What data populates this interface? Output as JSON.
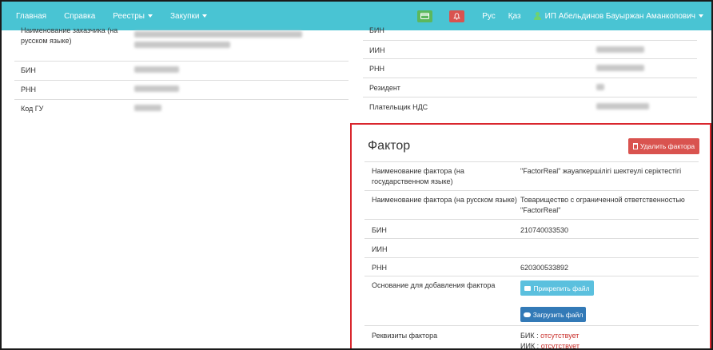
{
  "navbar": {
    "items": [
      {
        "label": "Главная",
        "dropdown": false
      },
      {
        "label": "Справка",
        "dropdown": false
      },
      {
        "label": "Реестры",
        "dropdown": true
      },
      {
        "label": "Закупки",
        "dropdown": true
      }
    ],
    "lang_ru": "Рус",
    "lang_kz": "Қаз",
    "user": "ИП Абельдинов Бауыржан Аманкопович",
    "card_icon": "credit-card-icon",
    "bell_icon": "bell-icon",
    "colors": {
      "bar": "#49c4d3",
      "green": "#5cb85c",
      "red": "#d9534f"
    }
  },
  "customer_table": {
    "rows": [
      {
        "label": "Наименование заказчика (на русском языке)"
      },
      {
        "label": "БИН"
      },
      {
        "label": "РНН"
      },
      {
        "label": "Код ГУ"
      }
    ]
  },
  "supplier_table": {
    "rows": [
      {
        "label": "БИН"
      },
      {
        "label": "ИИН"
      },
      {
        "label": "РНН"
      },
      {
        "label": "Резидент"
      },
      {
        "label": "Плательщик НДС"
      }
    ]
  },
  "factor": {
    "title": "Фактор",
    "delete_button": "Удалить фактора",
    "rows": {
      "name_kz_label": "Наименование фактора (на государственном языке)",
      "name_kz_value": "\"FactorReal\" жауапкершілігі шектеулі серіктестігі",
      "name_ru_label": "Наименование фактора (на русском языке)",
      "name_ru_value": "Товарищество с ограниченной ответственностью \"FactorReal\"",
      "bin_label": "БИН",
      "bin_value": "210740033530",
      "iin_label": "ИИН",
      "iin_value": "",
      "rnn_label": "РНН",
      "rnn_value": "620300533892",
      "basis_label": "Основание для добавления фактора",
      "attach_button": "Прикрепить файл",
      "upload_button": "Загрузить файл",
      "requisites_label": "Реквизиты фактора",
      "bik_label": "БИК :",
      "bik_value": "отсутствует",
      "iik_label": "ИИК :",
      "iik_value": "отсутствует"
    },
    "colors": {
      "border": "#d9262d",
      "missing": "#c9302c"
    }
  }
}
